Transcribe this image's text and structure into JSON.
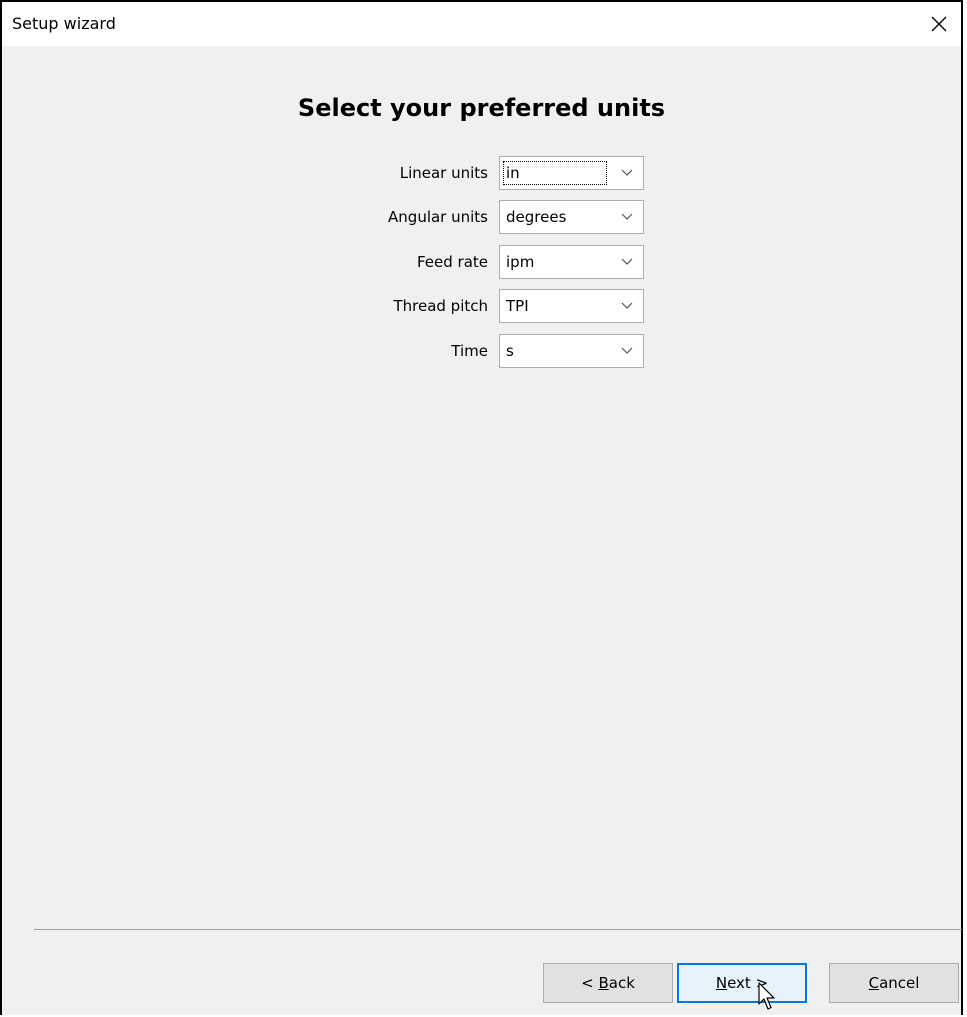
{
  "window": {
    "title": "Setup wizard"
  },
  "page": {
    "heading": "Select your preferred units"
  },
  "form": {
    "rows": [
      {
        "label": "Linear units",
        "value": "in"
      },
      {
        "label": "Angular units",
        "value": "degrees"
      },
      {
        "label": "Feed rate",
        "value": "ipm"
      },
      {
        "label": "Thread pitch",
        "value": "TPI"
      },
      {
        "label": "Time",
        "value": "s"
      }
    ]
  },
  "buttons": {
    "back": {
      "prefix": "< ",
      "mnemonic": "B",
      "rest": "ack"
    },
    "next": {
      "mnemonic": "N",
      "rest": "ext >"
    },
    "cancel": {
      "mnemonic": "C",
      "rest": "ancel"
    }
  },
  "colors": {
    "window_bg": "#f0f0f0",
    "titlebar_bg": "#ffffff",
    "primary_button_border": "#0078d7",
    "primary_button_bg": "#e5f1fb"
  },
  "icons": {
    "close": "close-icon",
    "dropdown": "chevron-down-icon",
    "cursor": "mouse-cursor-icon"
  }
}
